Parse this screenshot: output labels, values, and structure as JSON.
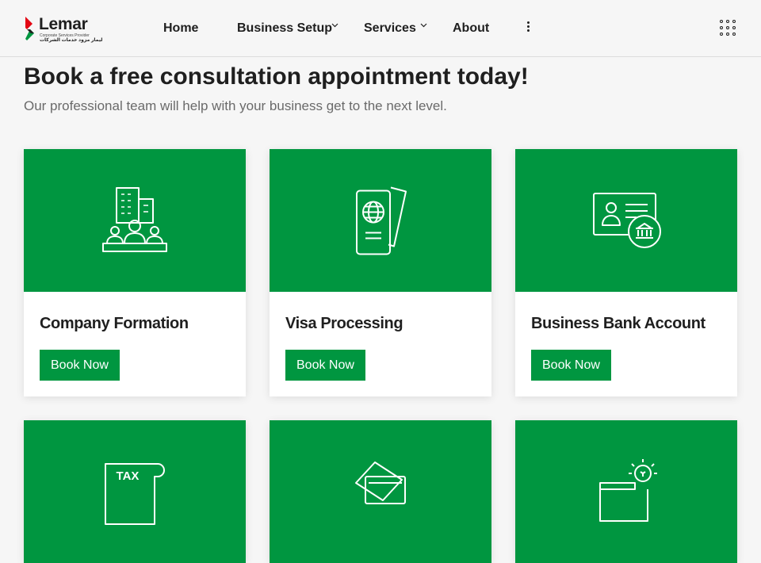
{
  "brand": {
    "name": "Lemar",
    "tagline": "Corporate Services Provider",
    "arabic": "ليمار مزود خدمات الشركات",
    "color": "#009640",
    "accent_red": "#e30613"
  },
  "nav": {
    "items": [
      {
        "label": "Home",
        "has_dropdown": false
      },
      {
        "label": "Business Setup",
        "has_dropdown": true
      },
      {
        "label": "Services",
        "has_dropdown": true
      },
      {
        "label": "About",
        "has_dropdown": false
      }
    ],
    "more_icon": "kebab-icon",
    "apps_icon": "grid-menu-icon"
  },
  "intro": {
    "title": "Book a free consultation appointment today!",
    "subtitle": "Our professional team will help with your business get to the next level."
  },
  "cards": [
    {
      "title": "Company Formation",
      "button": "Book Now",
      "icon": "company-building-icon"
    },
    {
      "title": "Visa Processing",
      "button": "Book Now",
      "icon": "passport-icon"
    },
    {
      "title": "Business Bank Account",
      "button": "Book Now",
      "icon": "bank-account-icon"
    },
    {
      "title": "",
      "button": "",
      "icon": "tax-icon",
      "icon_label": "TAX"
    },
    {
      "title": "",
      "button": "",
      "icon": "cards-icon"
    },
    {
      "title": "",
      "button": "",
      "icon": "idea-icon"
    }
  ]
}
